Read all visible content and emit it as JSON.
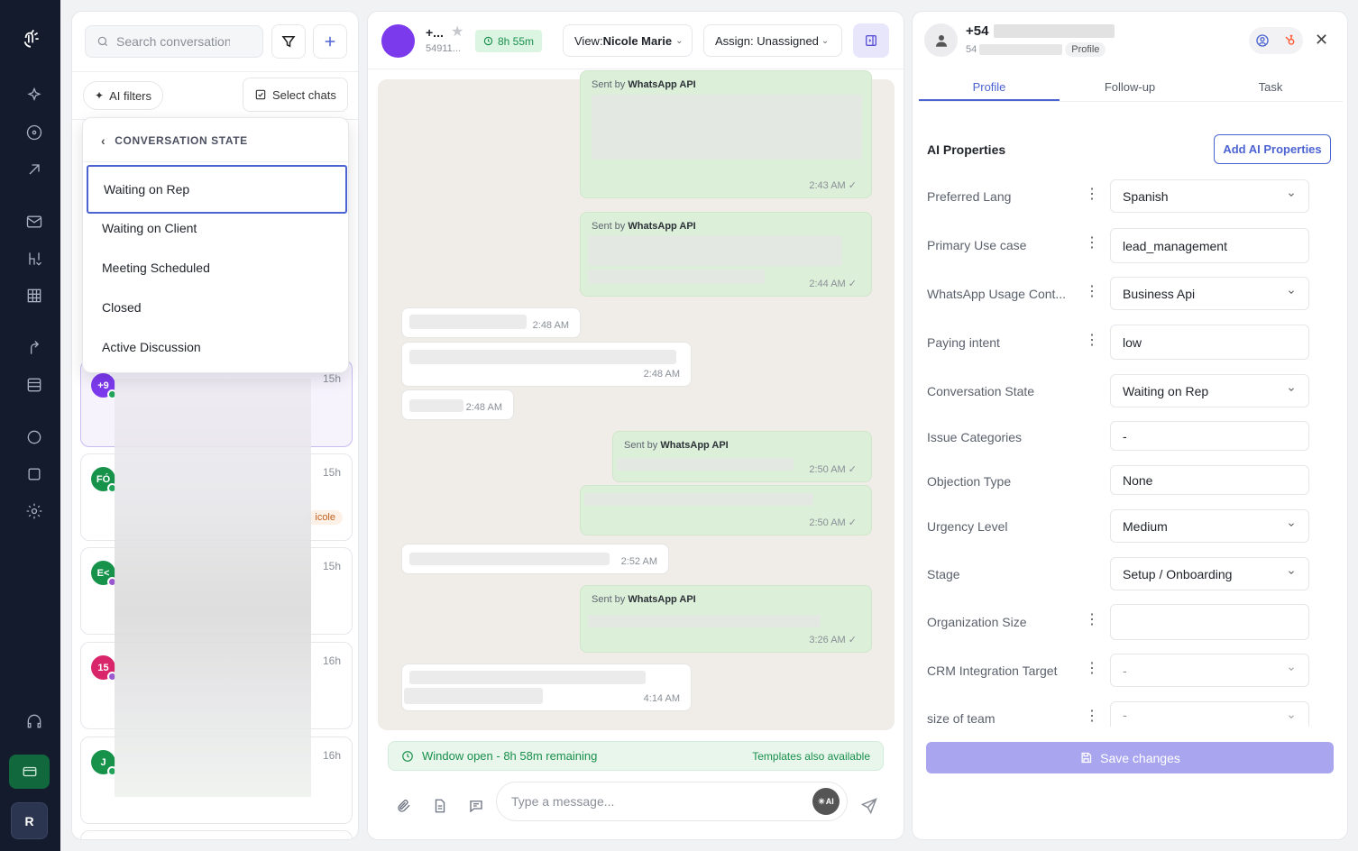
{
  "nav": {
    "user_initial": "R"
  },
  "left": {
    "search_placeholder": "Search conversations",
    "ai_filters": "AI filters",
    "select_chats": "Select chats",
    "dropdown": {
      "title": "CONVERSATION STATE",
      "items": [
        "Waiting on Rep",
        "Waiting on Client",
        "Meeting Scheduled",
        "Closed",
        "Active Discussion"
      ],
      "selected": "Waiting on Rep"
    },
    "cards": [
      {
        "initials": "+9",
        "time": "15h",
        "color": "#7c3aed",
        "dot": "#22a35a"
      },
      {
        "initials": "FÓ",
        "time": "15h",
        "color": "#17924b",
        "dot": "#22a35a",
        "tag": "icole"
      },
      {
        "initials": "E<",
        "time": "15h",
        "color": "#17924b",
        "dot": "#9b59d0"
      },
      {
        "initials": "15",
        "time": "16h",
        "color": "#d9266a",
        "dot": "#9b59d0"
      },
      {
        "initials": "J",
        "time": "16h",
        "color": "#17924b",
        "dot": "#22a35a"
      }
    ]
  },
  "center": {
    "contact_name": "+...",
    "contact_sub": "54911...",
    "timer": "8h 55m",
    "view_label": "View:",
    "view_value": "Nicole Marie",
    "assign_label": "Assign: Unassigned",
    "sender_prefix": "Sent by",
    "sender_name": "WhatsApp API",
    "messages": [
      {
        "time": "2:43 AM"
      },
      {
        "time": "2:44 AM"
      },
      {
        "time": "2:48 AM"
      },
      {
        "time": "2:48 AM"
      },
      {
        "time": "2:48 AM"
      },
      {
        "time": "2:50 AM"
      },
      {
        "time": "2:50 AM"
      },
      {
        "time": "2:52 AM"
      },
      {
        "time": "3:26 AM"
      },
      {
        "time": "4:14 AM"
      }
    ],
    "window_status": "Window open - 8h 58m remaining",
    "templates_note": "Templates also available",
    "composer_placeholder": "Type a message...",
    "ai_badge": "AI"
  },
  "right": {
    "phone": "+54",
    "sub": "54",
    "profile_badge": "Profile",
    "tabs": [
      "Profile",
      "Follow-up",
      "Task"
    ],
    "section_title": "AI Properties",
    "add_button": "Add AI Properties",
    "properties": [
      {
        "label": "Preferred Lang",
        "value": "Spanish",
        "type": "select",
        "kebab": true
      },
      {
        "label": "Primary Use case",
        "value": "lead_management",
        "type": "text",
        "kebab": true
      },
      {
        "label": "WhatsApp Usage Cont...",
        "value": "Business Api",
        "type": "select",
        "kebab": true
      },
      {
        "label": "Paying intent",
        "value": "low",
        "type": "text",
        "kebab": true
      },
      {
        "label": "Conversation State",
        "value": "Waiting on Rep",
        "type": "select",
        "kebab": false
      },
      {
        "label": "Issue Categories",
        "value": "-",
        "type": "text",
        "kebab": false
      },
      {
        "label": "Objection Type",
        "value": "None",
        "type": "text",
        "kebab": false
      },
      {
        "label": "Urgency Level",
        "value": "Medium",
        "type": "select",
        "kebab": false
      },
      {
        "label": "Stage",
        "value": "Setup / Onboarding",
        "type": "select",
        "kebab": false
      },
      {
        "label": "Organization Size",
        "value": "",
        "type": "text",
        "kebab": true
      },
      {
        "label": "CRM Integration Target",
        "value": "-",
        "type": "select",
        "kebab": true
      },
      {
        "label": "size of team",
        "value": "-",
        "type": "select",
        "kebab": true
      }
    ],
    "save_button": "Save changes"
  },
  "colors": {
    "accent": "#4c63d2",
    "green": "#1a8f4c",
    "save": "#a9a6ef"
  }
}
